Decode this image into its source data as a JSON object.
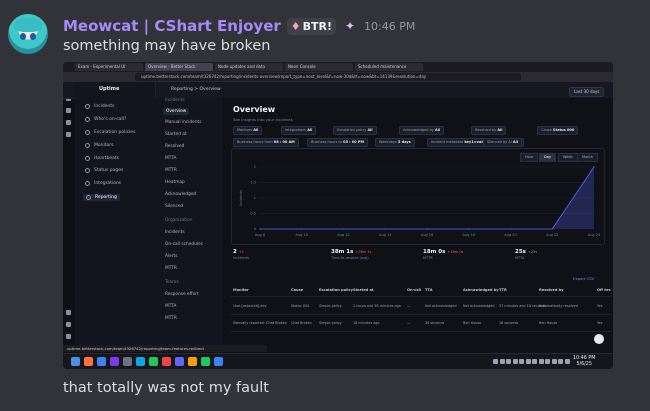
{
  "message": {
    "username": "Meowcat | CShart Enjoyer",
    "badge": {
      "icon": "pink-icon",
      "text": "BTR!"
    },
    "decoration_icon": "purple-sparkle-icon",
    "time": "10:46 PM",
    "text_top": "something may have broken",
    "text_bottom": "that totally was not my fault"
  },
  "screenshot": {
    "tabs": [
      {
        "label": "Exam - Experimental UI"
      },
      {
        "label": "Overview - Better Stack"
      },
      {
        "label": "Node updates and data"
      },
      {
        "label": "Neon Console"
      },
      {
        "label": "Scheduled maintenance"
      }
    ],
    "url": "uptime.betterstack.com/team/t326742/reporting/incidents-overview/report_type=next_level&f=now-30d&tt=now&bt=14139&resolution=day",
    "app": {
      "brand": "Uptime",
      "breadcrumb": "Reporting  >  Overview",
      "range_button": "Last 30 days",
      "nav": [
        {
          "label": "Incidents",
          "icon": "alert-icon"
        },
        {
          "label": "Who's on-call?",
          "icon": "user-icon"
        },
        {
          "label": "Escalation policies",
          "icon": "policy-icon"
        },
        {
          "label": "Monitors",
          "icon": "monitor-icon"
        },
        {
          "label": "Heartbeats",
          "icon": "heartbeat-icon"
        },
        {
          "label": "Status pages",
          "icon": "status-icon"
        },
        {
          "label": "Integrations",
          "icon": "plug-icon"
        },
        {
          "label": "Reporting",
          "icon": "chart-icon"
        }
      ],
      "subnav": [
        {
          "label": "Incidents",
          "kind": "group"
        },
        {
          "label": "Overview",
          "kind": "active"
        },
        {
          "label": "Manual incidents",
          "kind": "item"
        },
        {
          "label": "Started at",
          "kind": "item"
        },
        {
          "label": "Resolved",
          "kind": "item"
        },
        {
          "label": "MTTA",
          "kind": "item"
        },
        {
          "label": "MTTR",
          "kind": "item"
        },
        {
          "label": "Heatmap",
          "kind": "item"
        },
        {
          "label": "Acknowledged",
          "kind": "item"
        },
        {
          "label": "Silenced",
          "kind": "item"
        },
        {
          "label": "Organization",
          "kind": "group"
        },
        {
          "label": "Incidents",
          "kind": "item"
        },
        {
          "label": "On-call schedules",
          "kind": "item"
        },
        {
          "label": "Alerts",
          "kind": "item"
        },
        {
          "label": "MTTR",
          "kind": "item"
        },
        {
          "label": "Teams",
          "kind": "group"
        },
        {
          "label": "Response effort",
          "kind": "item"
        },
        {
          "label": "MTTA",
          "kind": "item"
        },
        {
          "label": "MTTR",
          "kind": "item"
        }
      ],
      "page_title": "Overview",
      "page_subtitle": "See insights into your incidents",
      "filters_row1": [
        {
          "label": "Monitors",
          "value": "All"
        },
        {
          "label": "Integrations",
          "value": "All"
        },
        {
          "label": "Escalation policy",
          "value": "All"
        },
        {
          "label": "Acknowledged by",
          "value": "All"
        },
        {
          "label": "Resolved by",
          "value": "All"
        },
        {
          "label": "Cause",
          "value": "Status 000"
        }
      ],
      "filters_row2": [
        {
          "label": "Business hours from",
          "value": "08 : 00   AM"
        },
        {
          "label": "Business hours to",
          "value": "05 : 00   PM"
        },
        {
          "label": "Weekdays",
          "value": "5 days"
        },
        {
          "label": "Incident metadata",
          "value": "key1=value1 OR key2=val..."
        },
        {
          "label": "Silenced by AI",
          "value": "All"
        }
      ],
      "granularity": [
        "Hour",
        "Day",
        "Week",
        "Month"
      ],
      "granularity_selected": "Day",
      "stats": [
        {
          "value": "2",
          "delta": "+1",
          "delta_good": false,
          "label": "Incidents"
        },
        {
          "value": "38m 1s",
          "delta": "+38m 1s",
          "delta_good": false,
          "label": "Time-to-resolve (avg)"
        },
        {
          "value": "18m 0s",
          "delta": "+18m 0s",
          "delta_good": false,
          "label": "MTTR"
        },
        {
          "value": "25s",
          "delta": "+25s",
          "delta_good": true,
          "label": "MTTA"
        }
      ],
      "export_label": "Export CSV",
      "table": {
        "columns": [
          "Monitor",
          "Cause",
          "Escalation policy",
          "Started at",
          "On-call",
          "TTA",
          "Acknowledged by",
          "TTR",
          "Resolved by",
          "Off hrs"
        ],
        "rows": [
          [
            "chat.[redacted].dev",
            "Status 000",
            "Simple policy",
            "2 hours and 38 minutes ago",
            "—",
            "Not acknowledged",
            "Not acknowledged",
            "37 minutes and 18 seconds",
            "Automatically resolved",
            "Yes"
          ],
          [
            "Manually reported: Chat Broken",
            "Chat Broken",
            "Simple policy",
            "18 minutes ago",
            "—",
            "30 seconds",
            "Ben House",
            "18 seconds",
            "Ben House",
            "Yes"
          ]
        ]
      }
    },
    "statusbar": "uptime.betterstack.com/team/t326742/reporting/team-features-redirect",
    "taskbar": {
      "time": "10:46 PM",
      "date": "5/6/25"
    }
  },
  "chart_data": {
    "type": "area",
    "title": "",
    "x": [
      "Aug 8",
      "Aug 10",
      "Aug 12",
      "Aug 14",
      "Aug 16",
      "Aug 18",
      "Aug 20",
      "Aug 22",
      "Aug 24"
    ],
    "ylim": [
      0,
      2
    ],
    "yticks": [
      0,
      0.5,
      1,
      1.5,
      2
    ],
    "ylabel": "Incidents",
    "series": [
      {
        "values": [
          0,
          0,
          0,
          0,
          0,
          0,
          0,
          0,
          2
        ]
      }
    ],
    "colors": {
      "series": "#5b6cff"
    }
  }
}
